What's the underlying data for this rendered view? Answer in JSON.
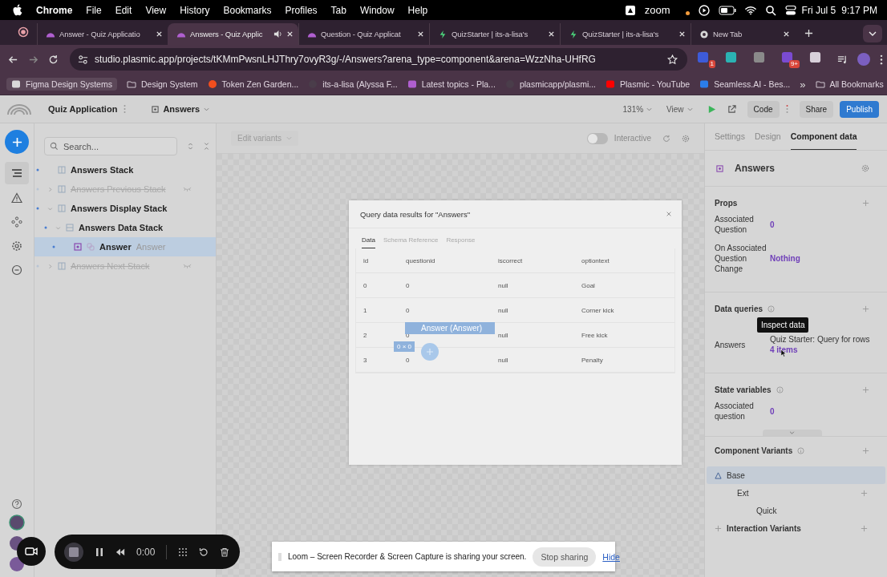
{
  "menubar": {
    "app": "Chrome",
    "items": [
      "File",
      "Edit",
      "View",
      "History",
      "Bookmarks",
      "Profiles",
      "Tab",
      "Window",
      "Help"
    ],
    "zoom_label": "zoom",
    "date": "Fri Jul 5",
    "time": "9:17 PM"
  },
  "tabs": [
    {
      "title": "Answer - Quiz Applicatio",
      "kind": "plasmic",
      "selected": false
    },
    {
      "title": "Answers - Quiz Applic",
      "kind": "plasmic",
      "selected": true
    },
    {
      "title": "Question - Quiz Applicat",
      "kind": "plasmic",
      "selected": false
    },
    {
      "title": "QuizStarter | its-a-lisa's",
      "kind": "bolt",
      "selected": false
    },
    {
      "title": "QuizStarter | its-a-lisa's",
      "kind": "bolt",
      "selected": false
    },
    {
      "title": "New Tab",
      "kind": "chrome",
      "selected": false
    }
  ],
  "address": "studio.plasmic.app/projects/tKMmPwsnLHJThry7ovyR3g/-/Answers?arena_type=component&arena=WzzNha-UHfRG",
  "extensions": [
    {
      "kind": "shield",
      "badge": "1"
    },
    {
      "kind": "atom"
    },
    {
      "kind": "hook"
    },
    {
      "kind": "burst",
      "badge": "9+"
    },
    {
      "kind": "puzzle"
    }
  ],
  "bookmarks": [
    {
      "title": "Figma Design Systems",
      "kind": "square"
    },
    {
      "title": "Design System",
      "kind": "folder"
    },
    {
      "title": "Token Zen Garden...",
      "kind": "figma"
    },
    {
      "title": "its-a-lisa (Alyssa F...",
      "kind": "github"
    },
    {
      "title": "Latest topics - Pla...",
      "kind": "plasmic"
    },
    {
      "title": "plasmicapp/plasmi...",
      "kind": "github"
    },
    {
      "title": "Plasmic - YouTube",
      "kind": "youtube"
    },
    {
      "title": "Seamless.AI - Bes...",
      "kind": "search"
    }
  ],
  "more_bookmarks": "»",
  "all_bookmarks": "All Bookmarks",
  "header": {
    "project": "Quiz Application",
    "component": "Answers",
    "zoom": "131%",
    "view": "View",
    "code": "Code",
    "share": "Share",
    "publish": "Publish"
  },
  "search": {
    "placeholder": "Search..."
  },
  "tree": [
    {
      "label": "Answers Stack",
      "kind": "stack",
      "hidden": false,
      "selected": false
    },
    {
      "label": "Answers Previous Stack",
      "kind": "stack",
      "hidden": true,
      "selected": false,
      "expanded": false
    },
    {
      "label": "Answers Display Stack",
      "kind": "stack",
      "hidden": false,
      "selected": false,
      "expanded": true,
      "children": [
        {
          "label": "Answers Data Stack",
          "kind": "vstack",
          "hidden": false,
          "selected": false,
          "expanded": true,
          "children": [
            {
              "label": "Answer",
              "component": "Answer",
              "kind": "component",
              "hidden": false,
              "selected": true
            }
          ]
        }
      ]
    },
    {
      "label": "Answers Next Stack",
      "kind": "stack",
      "hidden": true,
      "selected": false,
      "expanded": false
    }
  ],
  "canvas": {
    "edit_variants": "Edit variants",
    "interactive": {
      "label": "Interactive",
      "on": false
    }
  },
  "dialog": {
    "title": "Query data results for \"Answers\"",
    "tabs": [
      {
        "label": "Data",
        "selected": true
      },
      {
        "label": "Schema Reference",
        "selected": false
      },
      {
        "label": "Response",
        "selected": false
      }
    ],
    "columns": [
      "id",
      "questionid",
      "iscorrect",
      "optiontext"
    ],
    "rows": [
      [
        "0",
        "0",
        "null",
        "Goal"
      ],
      [
        "1",
        "0",
        "null",
        "Corner kick"
      ],
      [
        "2",
        "0",
        "null",
        "Free kick"
      ],
      [
        "3",
        "0",
        "null",
        "Penalty"
      ]
    ],
    "overlay_label": "Answer (Answer)",
    "overlay_size": "0 × 0"
  },
  "panel": {
    "tabs": [
      {
        "label": "Settings",
        "selected": false
      },
      {
        "label": "Design",
        "selected": false
      },
      {
        "label": "Component data",
        "selected": true
      }
    ],
    "component": "Answers",
    "props_title": "Props",
    "props": [
      {
        "label": "Associated Question",
        "value": "0"
      },
      {
        "label": "On Associated Question Change",
        "value": "Nothing"
      }
    ],
    "queries_title": "Data queries",
    "queries": [
      {
        "label": "Answers",
        "value": "Quiz Starter: Query for rows",
        "link": "4 items"
      }
    ],
    "tooltip": "Inspect data",
    "state_title": "State variables",
    "state": [
      {
        "label": "Associated question",
        "value": "0"
      }
    ],
    "variants_title": "Component Variants",
    "variants": [
      {
        "label": "Base",
        "kind": "base",
        "selected": true
      },
      {
        "label": "Ext",
        "kind": "group",
        "selected": false
      },
      {
        "label": "Quick",
        "kind": "variant",
        "selected": false
      },
      {
        "label": "Interaction Variants",
        "kind": "interaction",
        "selected": false
      }
    ]
  },
  "recorder": {
    "time": "0:00"
  },
  "loom": {
    "message": "Loom – Screen Recorder & Screen Capture is sharing your screen.",
    "stop": "Stop sharing",
    "hide": "Hide"
  }
}
